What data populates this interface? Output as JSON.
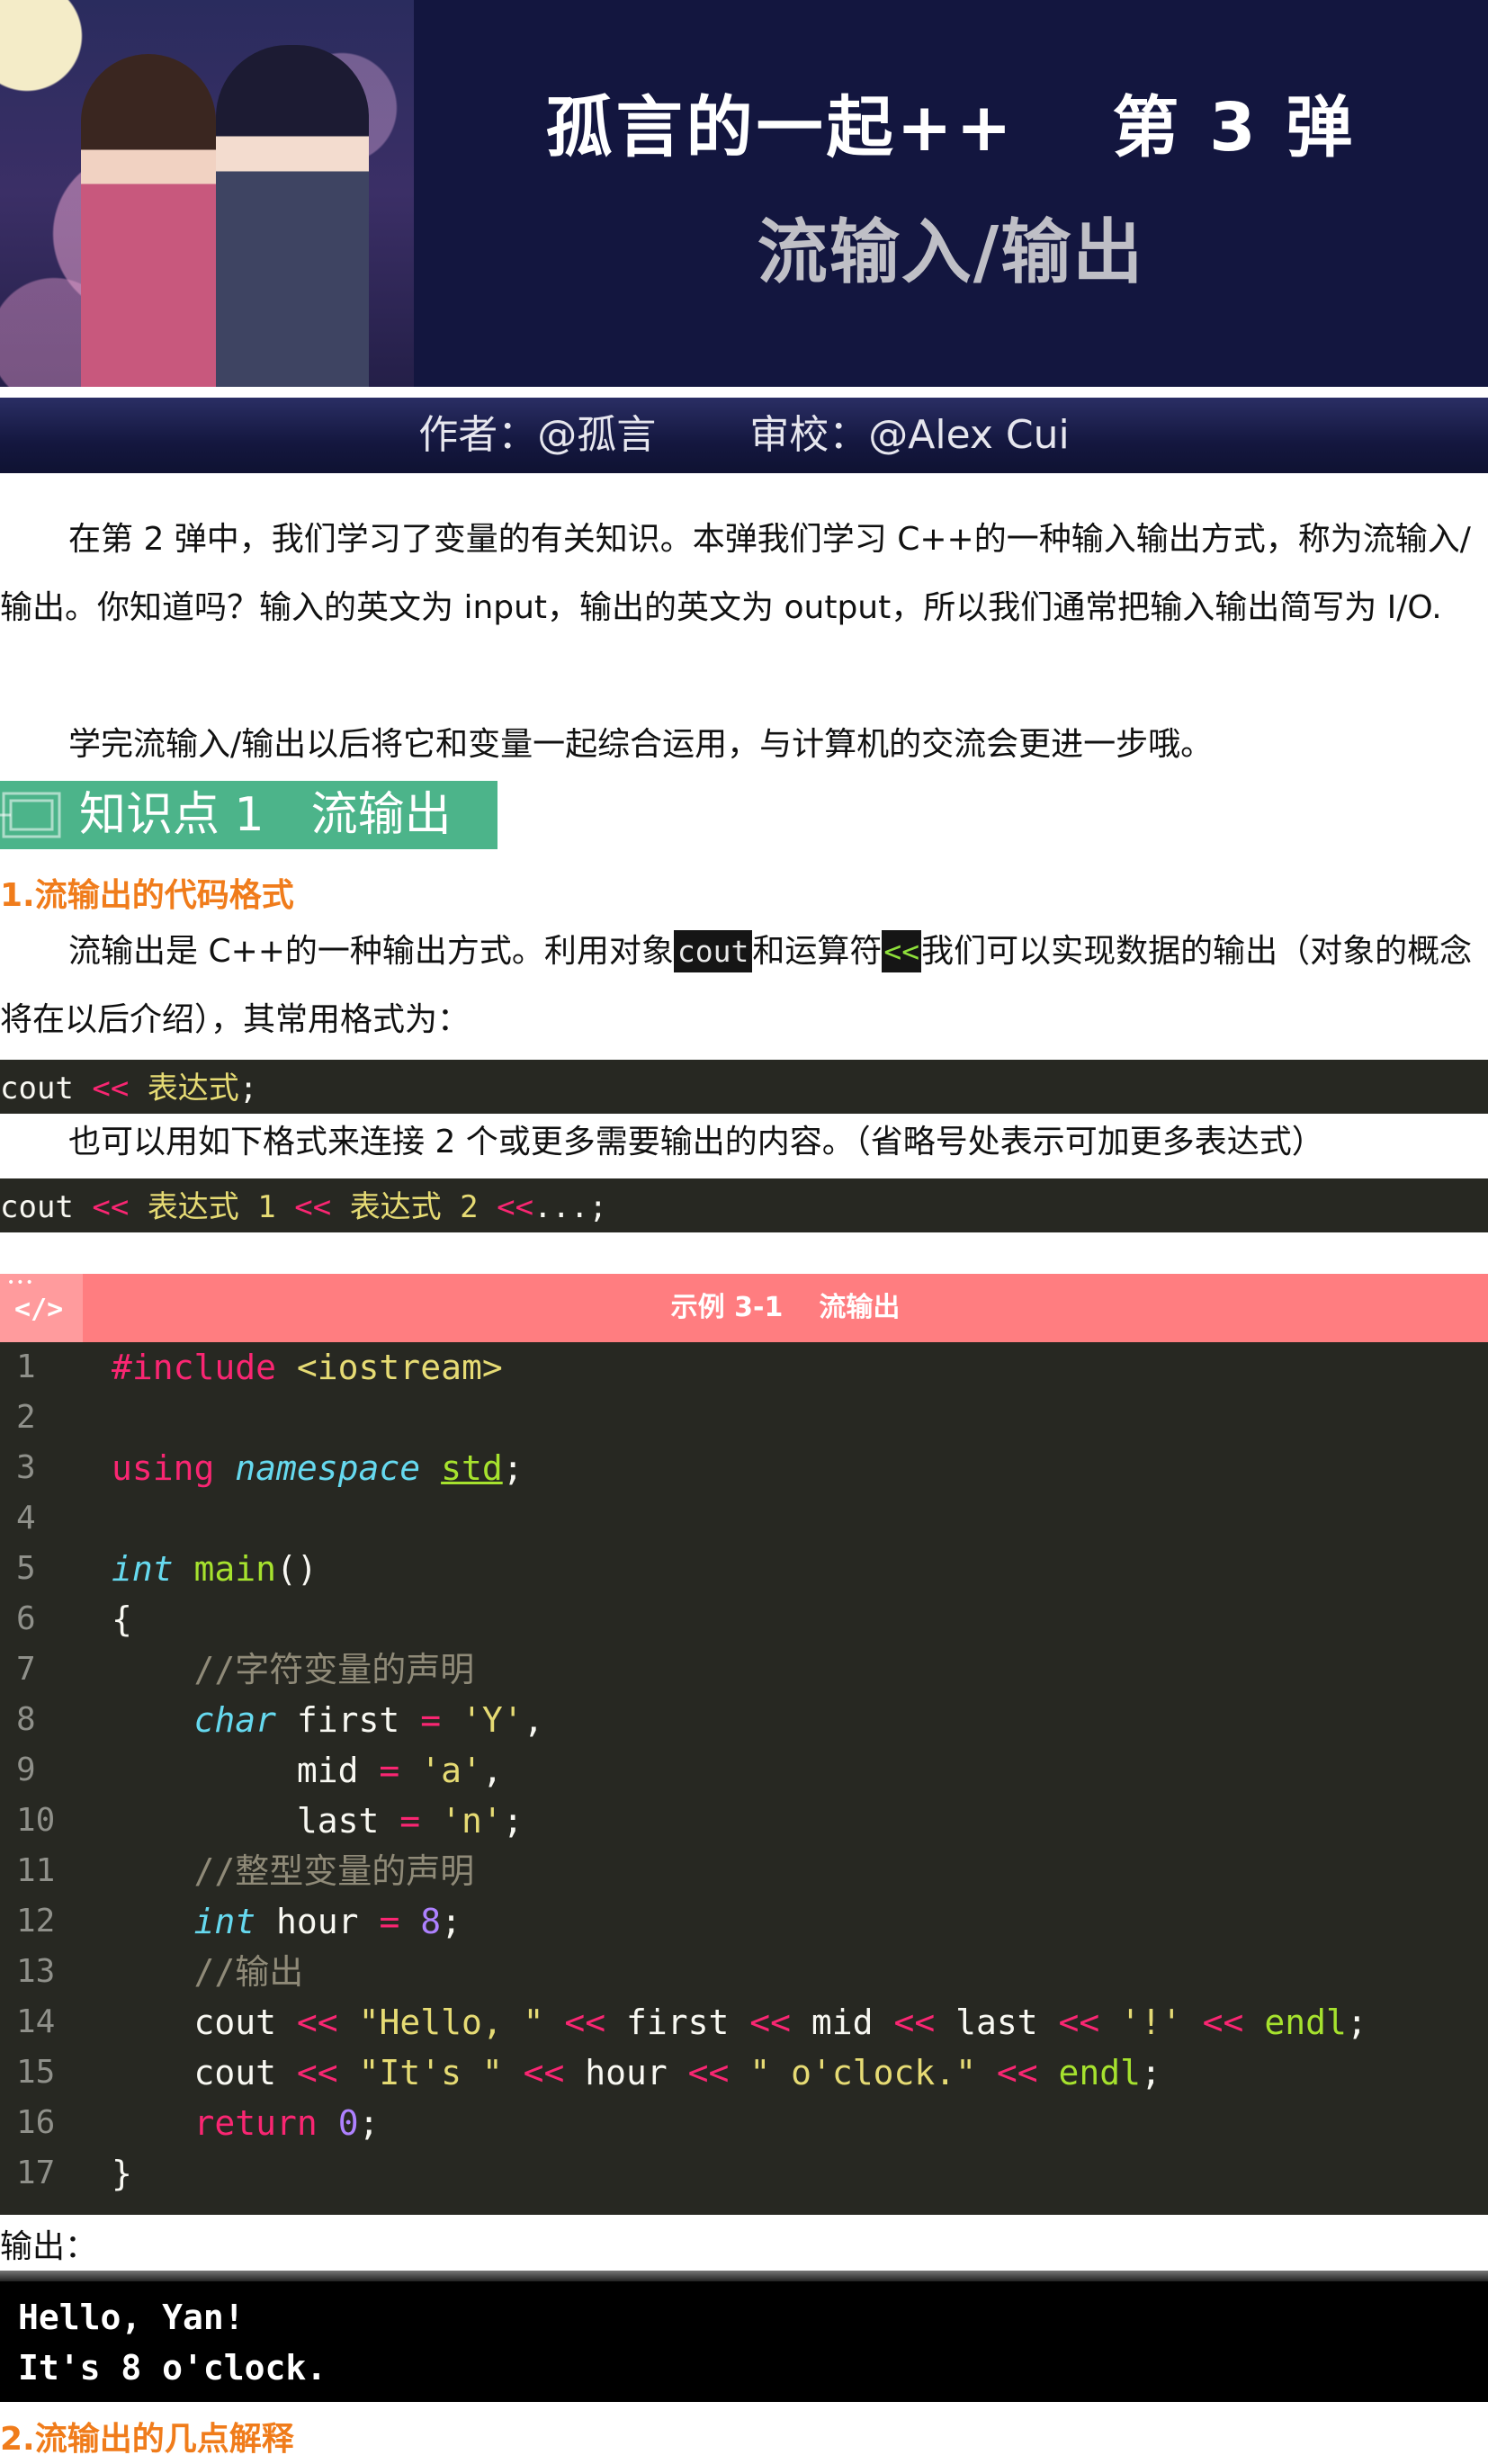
{
  "header": {
    "title": "孤言的一起++　 第 3 弹",
    "subtitle": "流输入/输出",
    "author": "作者：@孤言",
    "reviewer": "审校：@Alex Cui"
  },
  "intro": {
    "p1": "在第 2 弹中，我们学习了变量的有关知识。本弹我们学习 C++的一种输入输出方式，称为流输入/输出。你知道吗？输入的英文为 input，输出的英文为 output，所以我们通常把输入输出简写为 I/O.",
    "p2": "学完流输入/输出以后将它和变量一起综合运用，与计算机的交流会更进一步哦。"
  },
  "section1": {
    "title": "知识点 1　流输出",
    "sub1": "1.流输出的代码格式",
    "desc_a": "流输出是 C++的一种输出方式。利用对象",
    "desc_code1": "cout",
    "desc_b": "和运算符",
    "desc_code2": "<<",
    "desc_c": "我们可以实现数据的输出（对象的概念将在以后介绍），其常用格式为：",
    "format1": {
      "a": "cout",
      "op": "<<",
      "b": "表达式",
      "end": ";"
    },
    "note": "也可以用如下格式来连接 2 个或更多需要输出的内容。（省略号处表示可加更多表达式）",
    "format2": {
      "a": "cout",
      "op1": "<<",
      "e1": "表达式 1",
      "op2": "<<",
      "e2": "表达式 2",
      "op3": "<<",
      "tail": "...;"
    },
    "sub2": "2.流输出的几点解释"
  },
  "example": {
    "icon": "</>",
    "title_a": "示例 3-1",
    "title_b": "流输出",
    "line_numbers": [
      "1",
      "2",
      "3",
      "4",
      "5",
      "6",
      "7",
      "8",
      "9",
      "10",
      "11",
      "12",
      "13",
      "14",
      "15",
      "16",
      "17"
    ],
    "output_label": "输出：",
    "output_lines": [
      "Hello, Yan!",
      "It's 8 o'clock."
    ]
  },
  "colors": {
    "banner_bg": "#13163f",
    "section_green": "#4cb48a",
    "subhead_orange": "#f07c1b",
    "example_header": "#ff7d80",
    "code_bg": "#272822"
  }
}
